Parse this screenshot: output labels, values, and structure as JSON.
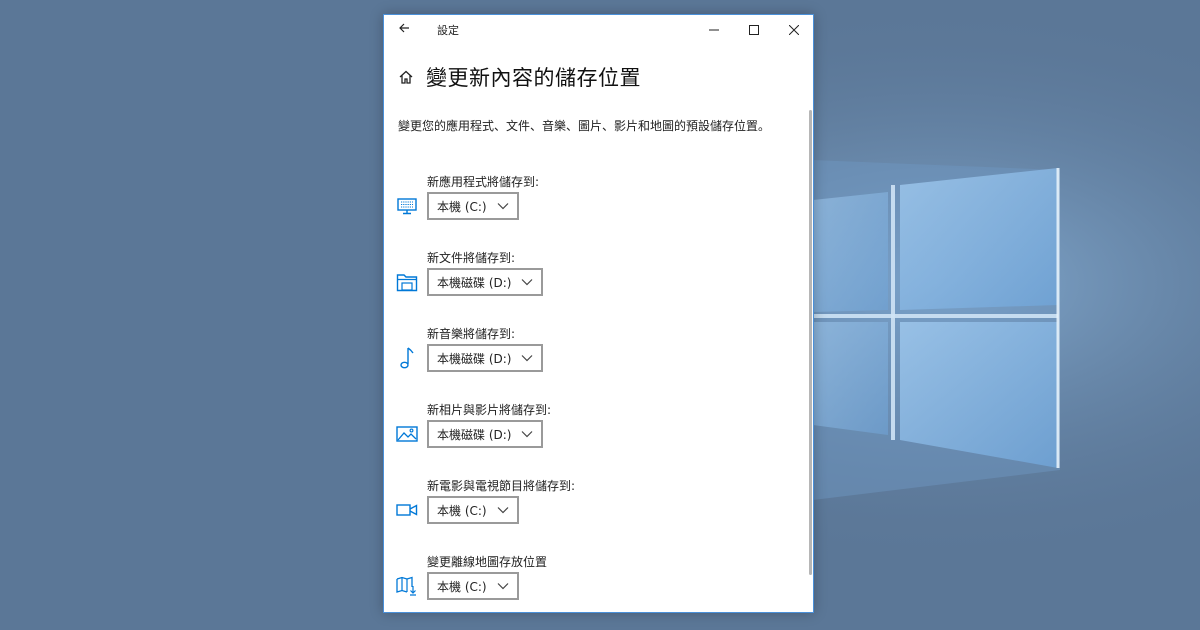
{
  "window": {
    "title": "設定"
  },
  "page": {
    "title": "變更新內容的儲存位置",
    "description": "變更您的應用程式、文件、音樂、圖片、影片和地圖的預設儲存位置。"
  },
  "sections": [
    {
      "label": "新應用程式將儲存到:",
      "selected": "本機 (C:)",
      "icon": "monitor-icon"
    },
    {
      "label": "新文件將儲存到:",
      "selected": "本機磁碟 (D:)",
      "icon": "folder-icon"
    },
    {
      "label": "新音樂將儲存到:",
      "selected": "本機磁碟 (D:)",
      "icon": "music-note-icon"
    },
    {
      "label": "新相片與影片將儲存到:",
      "selected": "本機磁碟 (D:)",
      "icon": "picture-icon"
    },
    {
      "label": "新電影與電視節目將儲存到:",
      "selected": "本機 (C:)",
      "icon": "video-camera-icon"
    },
    {
      "label": "變更離線地圖存放位置",
      "selected": "本機 (C:)",
      "icon": "map-download-icon"
    }
  ],
  "colors": {
    "accent": "#0078d7",
    "window_border": "#4a90d9",
    "desktop_bg": "#5a7697"
  }
}
